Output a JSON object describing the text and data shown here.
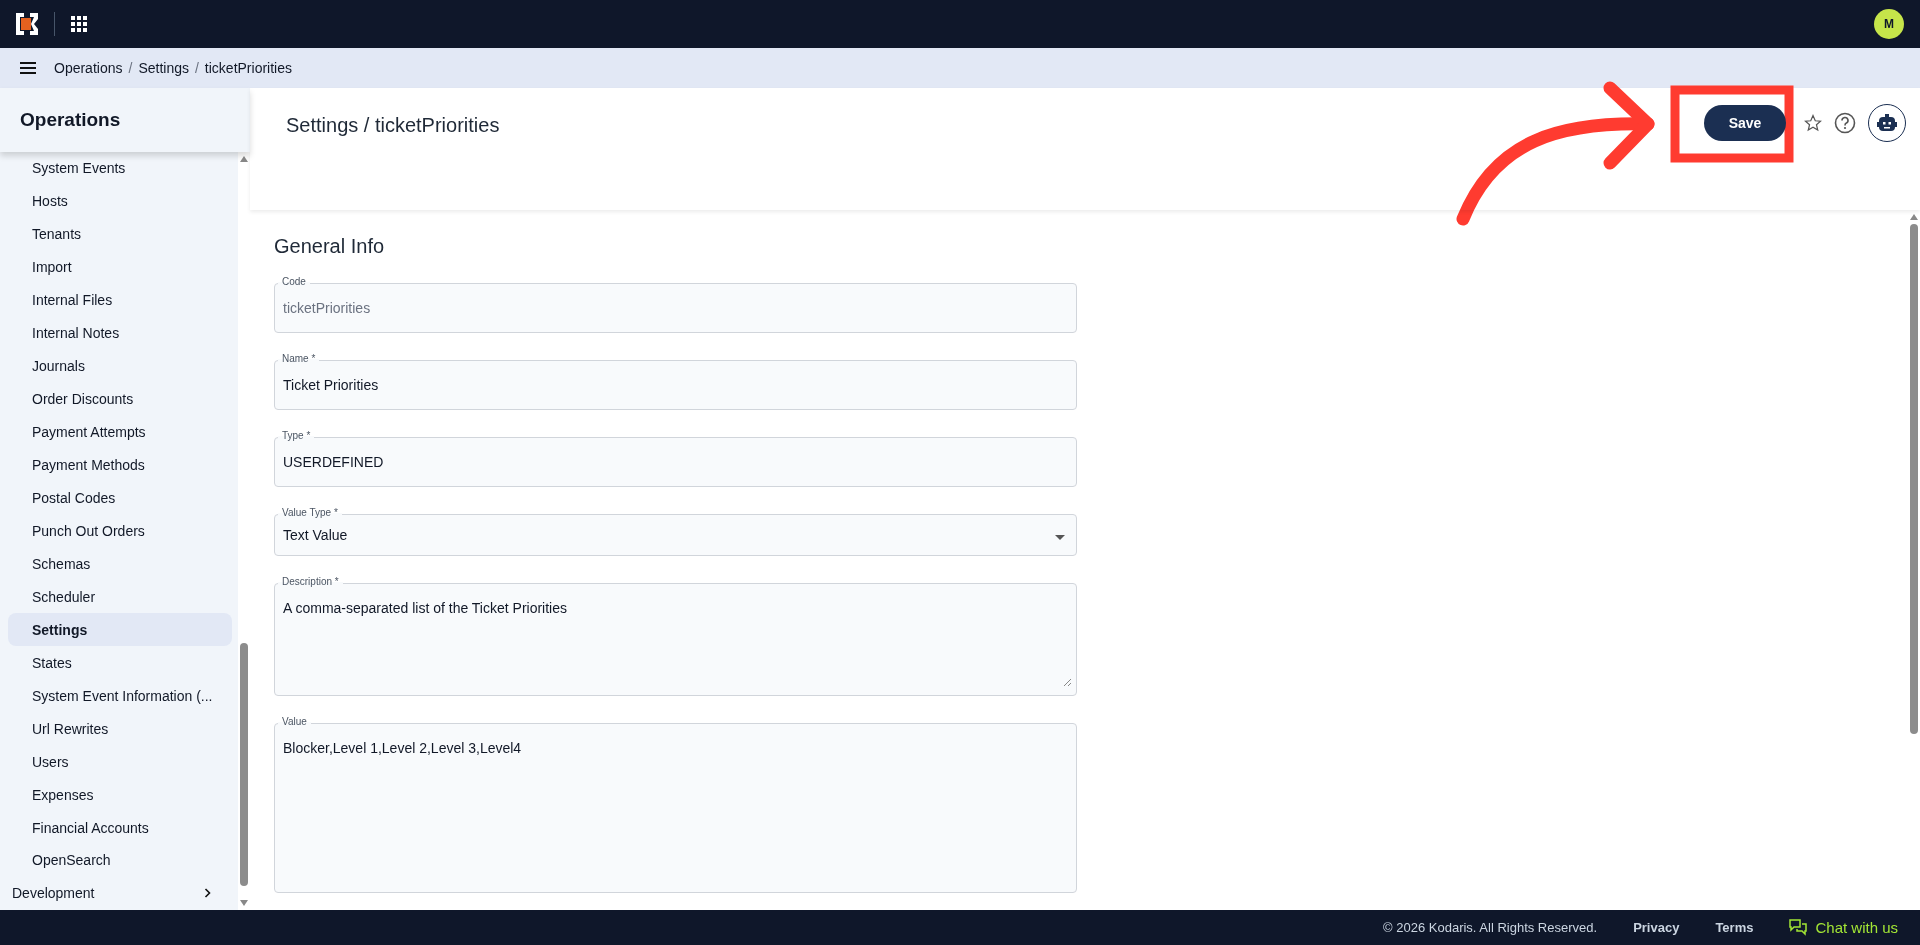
{
  "topbar": {
    "avatar": "M"
  },
  "breadcrumb": {
    "separator": "/",
    "items": [
      "Operations",
      "Settings",
      "ticketPriorities"
    ]
  },
  "sidebar": {
    "title": "Operations",
    "items": [
      {
        "label": "System Events",
        "selected": false
      },
      {
        "label": "Hosts",
        "selected": false
      },
      {
        "label": "Tenants",
        "selected": false
      },
      {
        "label": "Import",
        "selected": false
      },
      {
        "label": "Internal Files",
        "selected": false
      },
      {
        "label": "Internal Notes",
        "selected": false
      },
      {
        "label": "Journals",
        "selected": false
      },
      {
        "label": "Order Discounts",
        "selected": false
      },
      {
        "label": "Payment Attempts",
        "selected": false
      },
      {
        "label": "Payment Methods",
        "selected": false
      },
      {
        "label": "Postal Codes",
        "selected": false
      },
      {
        "label": "Punch Out Orders",
        "selected": false
      },
      {
        "label": "Schemas",
        "selected": false
      },
      {
        "label": "Scheduler",
        "selected": false
      },
      {
        "label": "Settings",
        "selected": true
      },
      {
        "label": "States",
        "selected": false
      },
      {
        "label": "System Event Information (...",
        "selected": false
      },
      {
        "label": "Url Rewrites",
        "selected": false
      },
      {
        "label": "Users",
        "selected": false
      },
      {
        "label": "Expenses",
        "selected": false
      },
      {
        "label": "Financial Accounts",
        "selected": false
      },
      {
        "label": "OpenSearch",
        "selected": false
      }
    ],
    "sections": [
      {
        "label": "Development",
        "expanded": false
      }
    ]
  },
  "page": {
    "title": "Settings / ticketPriorities",
    "save_button": "Save"
  },
  "form": {
    "section_title": "General Info",
    "fields": [
      {
        "kind": "text",
        "label": "Code",
        "value": "ticketPriorities",
        "disabled": true
      },
      {
        "kind": "text",
        "label": "Name *",
        "value": "Ticket Priorities",
        "disabled": false
      },
      {
        "kind": "text",
        "label": "Type *",
        "value": "USERDEFINED",
        "disabled": false
      },
      {
        "kind": "select",
        "label": "Value Type *",
        "value": "Text Value",
        "disabled": false
      },
      {
        "kind": "textarea",
        "label": "Description *",
        "value": "A comma-separated list of the Ticket Priorities",
        "disabled": false
      },
      {
        "kind": "tall",
        "label": "Value",
        "value": "Blocker,Level 1,Level 2,Level 3,Level4",
        "disabled": false
      }
    ]
  },
  "footer": {
    "copyright": "© 2026 Kodaris. All Rights Reserved.",
    "links": [
      "Privacy",
      "Terms"
    ],
    "chat": "Chat with us"
  }
}
